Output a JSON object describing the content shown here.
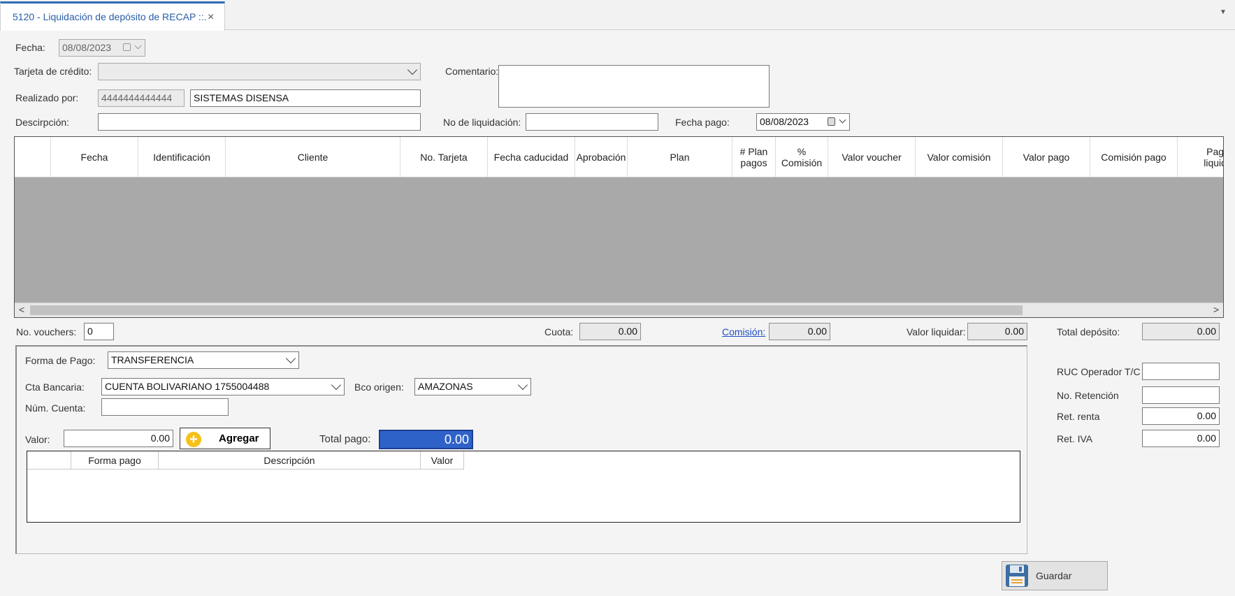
{
  "tab": {
    "title": "5120 - Liquidación de depósito de RECAP ::.",
    "close": "×",
    "menu": "▼"
  },
  "form": {
    "fecha_label": "Fecha:",
    "fecha_value": "08/08/2023",
    "tarjeta_label": "Tarjeta de crédito:",
    "tarjeta_value": "",
    "comentario_label": "Comentario:",
    "comentario_value": "",
    "realizado_label": "Realizado por:",
    "realizado_id": "4444444444444",
    "realizado_name": "SISTEMAS DISENSA",
    "descripcion_label": "Descirpción:",
    "descripcion_value": "",
    "liquidacion_label": "No de liquidación:",
    "liquidacion_value": "",
    "fecha_pago_label": "Fecha pago:",
    "fecha_pago_value": "08/08/2023"
  },
  "grid": {
    "columns": [
      "Fecha",
      "Identificación",
      "Cliente",
      "No. Tarjeta",
      "Fecha caducidad",
      "Aprobación",
      "Plan",
      "# Plan pagos",
      "% Comisión",
      "Valor voucher",
      "Valor comisión",
      "Valor pago",
      "Comisión pago",
      "Pago liquida"
    ],
    "left_arrow": "<",
    "right_arrow": ">"
  },
  "summary": {
    "vouchers_label": "No. vouchers:",
    "vouchers_value": "0",
    "cuota_label": "Cuota:",
    "cuota_value": "0.00",
    "comision_label": "Comisión:",
    "comision_value": "0.00",
    "valor_liquidar_label": "Valor liquidar:",
    "valor_liquidar_value": "0.00",
    "total_deposito_label": "Total depósito:",
    "total_deposito_value": "0.00"
  },
  "payment": {
    "forma_label": "Forma de Pago:",
    "forma_value": "TRANSFERENCIA",
    "cta_label": "Cta Bancaria:",
    "cta_value": "CUENTA BOLIVARIANO 1755004488",
    "bco_label": "Bco origen:",
    "bco_value": "AMAZONAS",
    "num_cuenta_label": "Núm. Cuenta:",
    "num_cuenta_value": "",
    "valor_label": "Valor:",
    "valor_value": "0.00",
    "agregar_label": "Agregar",
    "total_pago_label": "Total pago:",
    "total_pago_value": "0.00",
    "columns": [
      "Forma pago",
      "Descripción",
      "Valor"
    ]
  },
  "side": {
    "ruc_label": "RUC Operador T/C",
    "ruc_value": "",
    "retencion_label": "No. Retención",
    "retencion_value": "",
    "ret_renta_label": "Ret. renta",
    "ret_renta_value": "0.00",
    "ret_iva_label": "Ret. IVA",
    "ret_iva_value": "0.00"
  },
  "actions": {
    "guardar_label": "Guardar"
  }
}
